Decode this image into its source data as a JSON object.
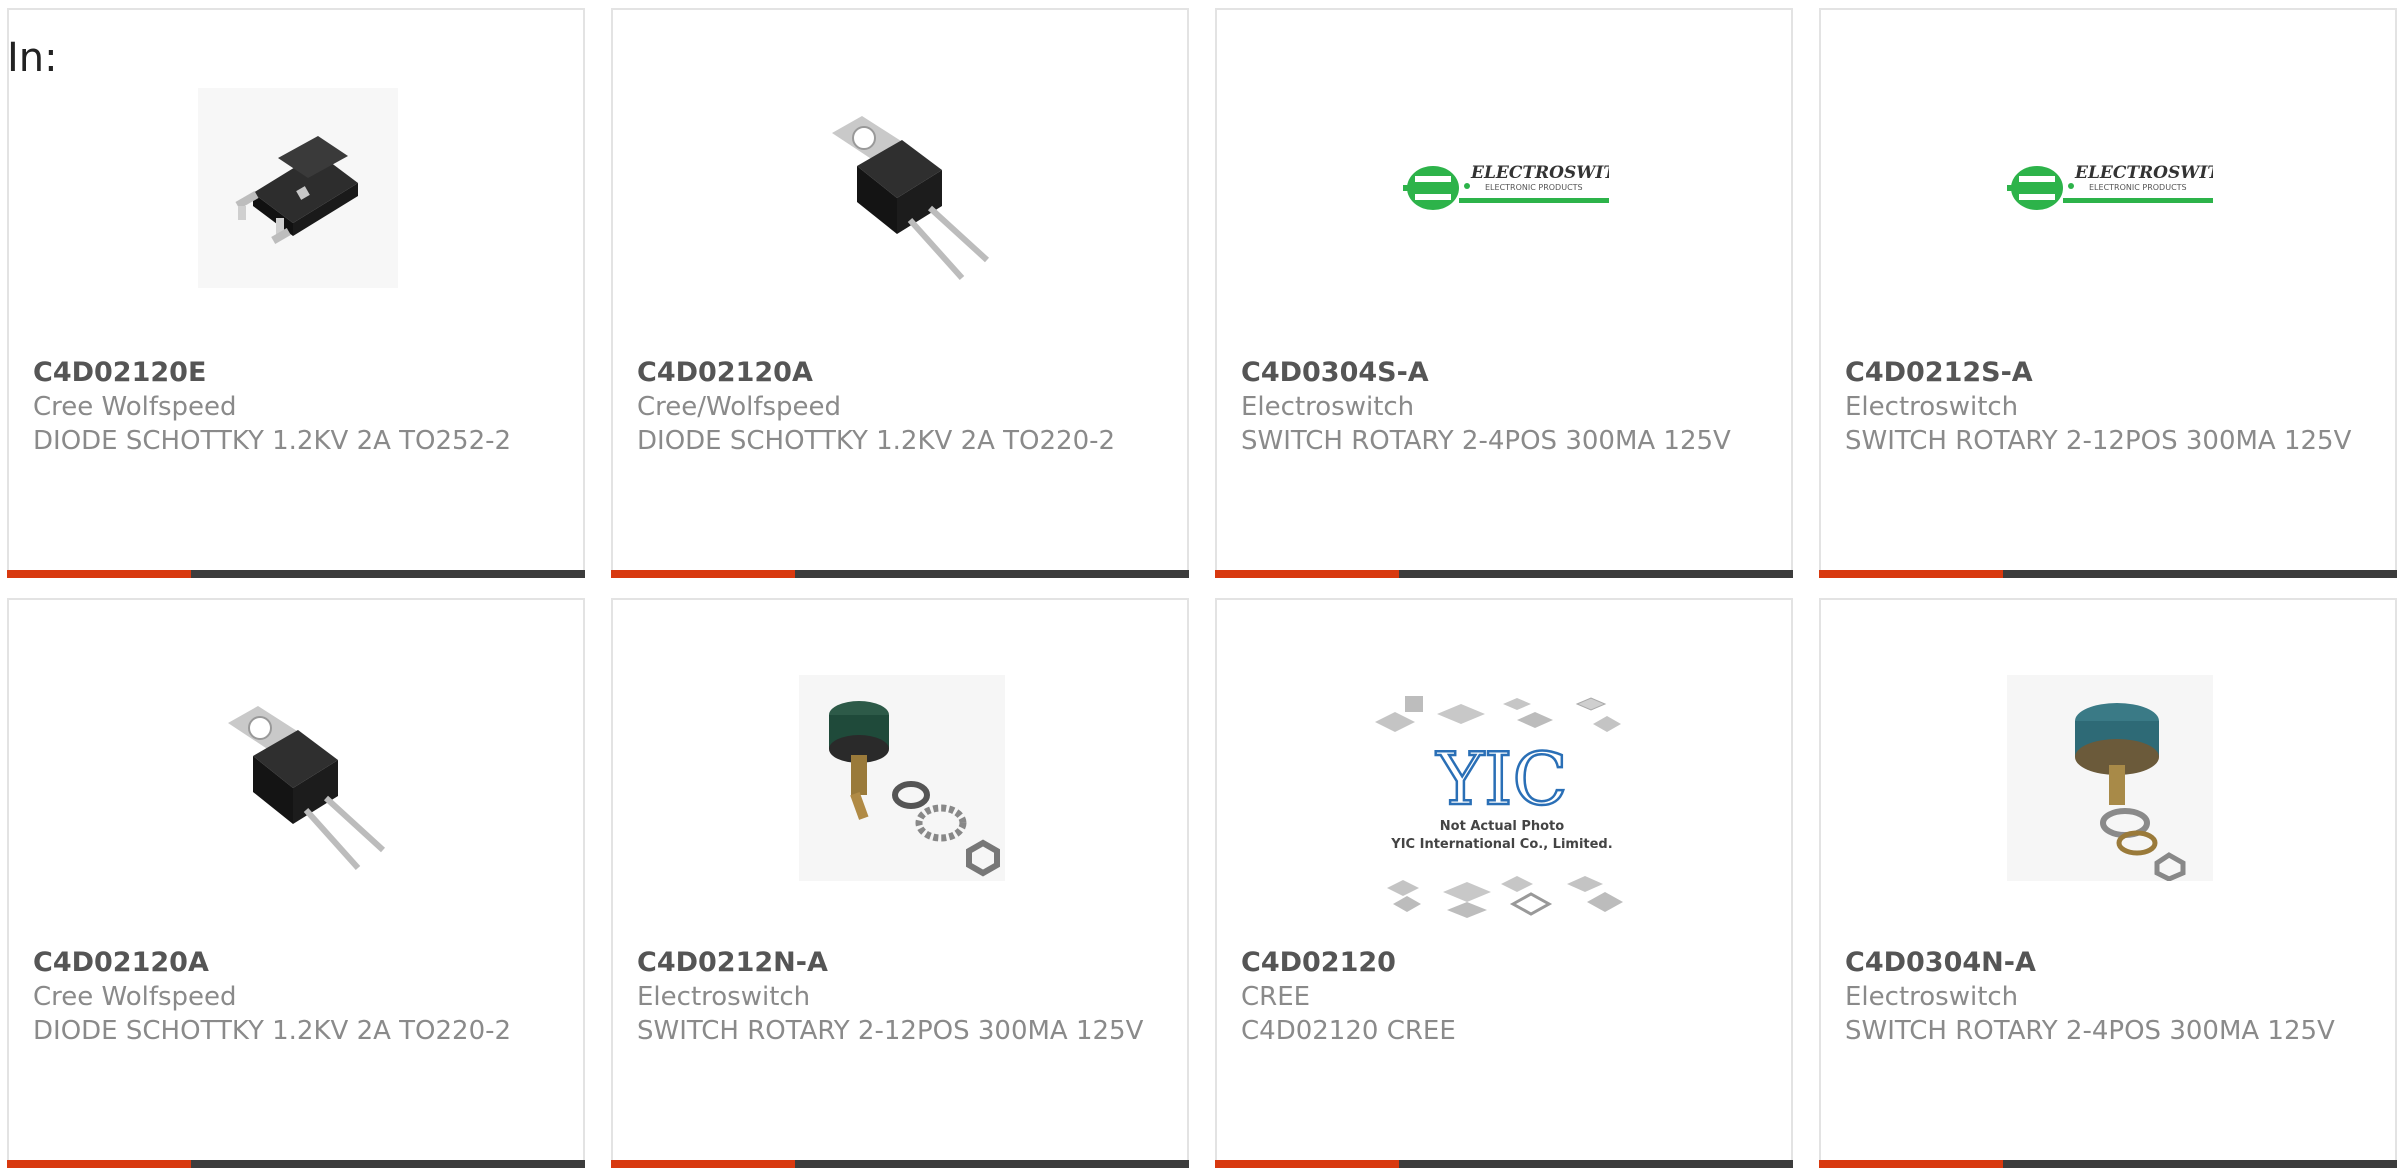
{
  "header": {
    "in_label": "In:"
  },
  "colors": {
    "accent": "#d8390f",
    "bar": "#3c3c3c",
    "border": "#e3e3e3"
  },
  "products": [
    {
      "part": "C4D02120E",
      "manufacturer": "Cree Wolfspeed",
      "description": "DIODE SCHOTTKY 1.2KV 2A TO252-2",
      "image": "to252-package-icon"
    },
    {
      "part": "C4D02120A",
      "manufacturer": "Cree/Wolfspeed",
      "description": "DIODE SCHOTTKY 1.2KV 2A TO220-2",
      "image": "to220-package-icon"
    },
    {
      "part": "C4D0304S-A",
      "manufacturer": "Electroswitch",
      "description": "SWITCH ROTARY 2-4POS 300MA 125V",
      "image": "electroswitch-logo"
    },
    {
      "part": "C4D0212S-A",
      "manufacturer": "Electroswitch",
      "description": "SWITCH ROTARY 2-12POS 300MA 125V",
      "image": "electroswitch-logo"
    },
    {
      "part": "C4D02120A",
      "manufacturer": "Cree Wolfspeed",
      "description": "DIODE SCHOTTKY 1.2KV 2A TO220-2",
      "image": "to220-package-icon"
    },
    {
      "part": "C4D0212N-A",
      "manufacturer": "Electroswitch",
      "description": "SWITCH ROTARY 2-12POS 300MA 125V",
      "image": "rotary-switch-icon"
    },
    {
      "part": "C4D02120",
      "manufacturer": "CREE",
      "description": "C4D02120 CREE",
      "image": "yic-placeholder",
      "placeholder": {
        "brand": "YIC",
        "line1": "Not Actual Photo",
        "line2": "YIC International Co., Limited."
      }
    },
    {
      "part": "C4D0304N-A",
      "manufacturer": "Electroswitch",
      "description": "SWITCH ROTARY 2-4POS 300MA 125V",
      "image": "rotary-switch-icon"
    }
  ],
  "logo": {
    "name": "ELECTROSWITCH",
    "tagline": "ELECTRONIC PRODUCTS"
  }
}
